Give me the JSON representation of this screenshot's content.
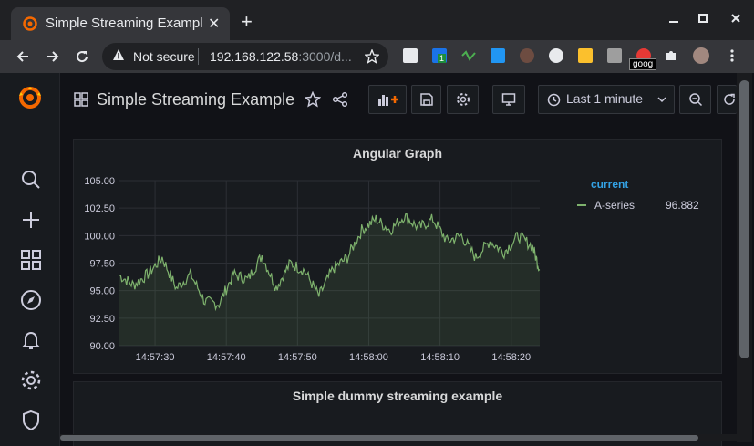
{
  "browser": {
    "tab_title": "Simple Streaming Example",
    "tab_close": "✕",
    "new_tab": "+",
    "security_label": "Not secure",
    "url_host": "192.168.122.58",
    "url_rest": ":3000/d...",
    "tooltip": "goog",
    "extension_badge": "1"
  },
  "dashboard": {
    "title": "Simple Streaming Example",
    "time_range": "Last 1 minute"
  },
  "panels": [
    {
      "title": "Angular Graph",
      "legend_header": "current",
      "series_name": "A-series",
      "series_current": "96.882",
      "y_ticks": [
        "105.00",
        "102.50",
        "100.00",
        "97.50",
        "95.00",
        "92.50",
        "90.00"
      ],
      "x_ticks": [
        "14:57:30",
        "14:57:40",
        "14:57:50",
        "14:58:00",
        "14:58:10",
        "14:58:20"
      ]
    },
    {
      "title": "Simple dummy streaming example"
    }
  ],
  "colors": {
    "series": "#7eb26d",
    "legend_header": "#33a2e5",
    "grafana_logo": "#f46800"
  },
  "chart_data": {
    "type": "line",
    "title": "Angular Graph",
    "x": [
      "14:57:25",
      "14:57:27",
      "14:57:29",
      "14:57:31",
      "14:57:33",
      "14:57:35",
      "14:57:37",
      "14:57:39",
      "14:57:41",
      "14:57:43",
      "14:57:45",
      "14:57:47",
      "14:57:49",
      "14:57:51",
      "14:57:53",
      "14:57:55",
      "14:57:57",
      "14:57:59",
      "14:58:01",
      "14:58:03",
      "14:58:05",
      "14:58:07",
      "14:58:09",
      "14:58:11",
      "14:58:13",
      "14:58:15",
      "14:58:17",
      "14:58:19",
      "14:58:21",
      "14:58:23",
      "14:58:24"
    ],
    "series": [
      {
        "name": "A-series",
        "values": [
          96.4,
          95.5,
          96.5,
          98.0,
          95.2,
          96.5,
          94.0,
          93.8,
          96.5,
          96.0,
          98.2,
          95.3,
          97.5,
          96.8,
          94.5,
          97.0,
          98.0,
          100.5,
          101.5,
          100.5,
          101.8,
          100.7,
          101.5,
          99.5,
          100.0,
          98.0,
          99.5,
          98.5,
          100.0,
          99.0,
          96.9
        ]
      }
    ],
    "xlabel": "",
    "ylabel": "",
    "ylim": [
      90,
      105
    ],
    "grid": true,
    "legend": "right",
    "legend_columns": [
      "current"
    ]
  }
}
